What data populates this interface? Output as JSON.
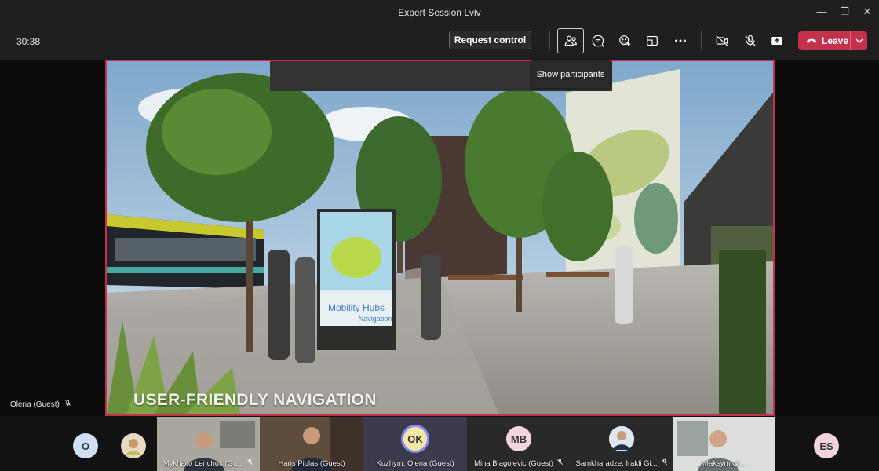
{
  "window": {
    "title": "Expert Session Lviv",
    "minimize_glyph": "—",
    "restore_glyph": "❐",
    "close_glyph": "✕"
  },
  "toolbar": {
    "timer": "30:38",
    "request_control_label": "Request control",
    "participants_icon": "people-icon",
    "chat_icon": "chat-icon",
    "reactions_icon": "reactions-icon",
    "rooms_icon": "breakout-rooms-icon",
    "more_icon": "more-icon",
    "camera_icon": "camera-off-icon",
    "mic_icon": "mic-off-icon",
    "share_icon": "share-tray-icon",
    "leave_label": "Leave",
    "leave_color": "#c4314b"
  },
  "tooltip": {
    "text": "Show participants"
  },
  "shared_content": {
    "caption": "USER-FRIENDLY NAVIGATION",
    "kiosk_line1": "Mobility Hubs",
    "kiosk_line2": "Navigation",
    "border_color": "#c4314b"
  },
  "presenter": {
    "name": "Olena (Guest)"
  },
  "participants": [
    {
      "initials": "O",
      "name": "",
      "avatar_color": "#cfe0f2"
    },
    {
      "initials": "",
      "name": "",
      "avatar_color": "#e8d9c4"
    },
    {
      "initials": "",
      "name": "Mykhailo Lenchuk (Gu...",
      "avatar_color": ""
    },
    {
      "initials": "",
      "name": "Haris Piplas (Guest)",
      "avatar_color": ""
    },
    {
      "initials": "OK",
      "name": "Kuzhym, Olena (Guest)",
      "avatar_color": "#f6e7a8"
    },
    {
      "initials": "MB",
      "name": "Mina Blagojevic (Guest)",
      "avatar_color": "#f4d4dd"
    },
    {
      "initials": "",
      "name": "Samkharadze, Irakli Gi...",
      "avatar_color": ""
    },
    {
      "initials": "",
      "name": "Maksym Cl...",
      "avatar_color": ""
    },
    {
      "initials": "ES",
      "name": "",
      "avatar_color": "#f4d4dd"
    }
  ]
}
